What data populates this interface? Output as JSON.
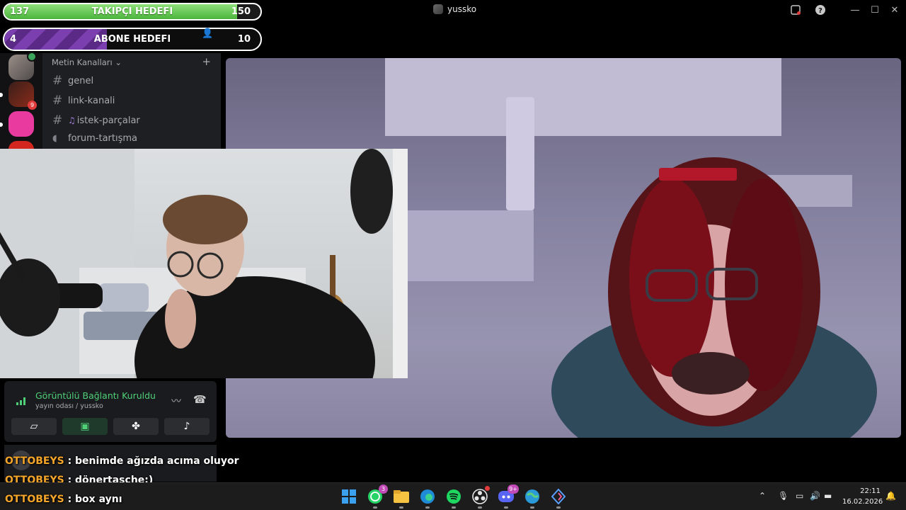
{
  "window": {
    "title": "yussko"
  },
  "goals": {
    "followers": {
      "current": "137",
      "label": "TAKIPÇI HEDEFI",
      "target": "150",
      "progress": 0.91
    },
    "subscribers": {
      "current": "4",
      "label": "ABONE HEDEFI",
      "target": "10",
      "progress": 0.4
    }
  },
  "sidebar": {
    "category": "Metin Kanalları",
    "channels": [
      {
        "name": "genel"
      },
      {
        "name": "link-kanali"
      },
      {
        "name": "istek-parçalar"
      },
      {
        "name": "forum-tartışma"
      }
    ],
    "server_badge": "9"
  },
  "voice": {
    "status": "Görüntülü Bağlantı Kuruldu",
    "room": "yayın odası",
    "user": "/ yussko"
  },
  "chat": [
    {
      "user": "OTTOBEYS",
      "message": ": benimde ağızda acıma oluyor"
    },
    {
      "user": "OTTOBEYS",
      "message": ": dönertasche:)"
    },
    {
      "user": "OTTOBEYS",
      "message": ": box aynı"
    }
  ],
  "taskbar": {
    "whatsapp_badge": "3",
    "discord_badge": "9+",
    "time": "22:11",
    "date": "16.02.2026"
  },
  "colors": {
    "follow_goal": "#5cc64a",
    "sub_goal": "#6a35a0",
    "chat_user": "#f4a52a",
    "connected": "#4fcf78"
  }
}
